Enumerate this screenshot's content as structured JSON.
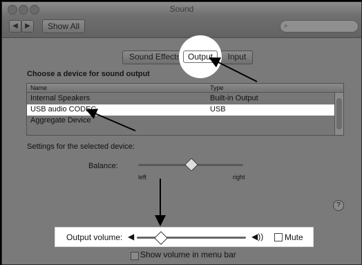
{
  "window": {
    "title": "Sound"
  },
  "toolbar": {
    "back_icon": "back-arrow-icon",
    "forward_icon": "forward-arrow-icon",
    "show_all": "Show All",
    "search_icon": "search-icon"
  },
  "tabs": [
    {
      "label": "Sound Effects"
    },
    {
      "label": "Output"
    },
    {
      "label": "Input"
    }
  ],
  "output": {
    "heading": "Choose a device for sound output",
    "columns": [
      "Name",
      "Type"
    ],
    "devices": [
      {
        "name": "Internal Speakers",
        "type": "Built-in Output"
      },
      {
        "name": "USB audio CODEC",
        "type": "USB"
      },
      {
        "name": "Aggregate Device",
        "type": ""
      }
    ]
  },
  "settings": {
    "label": "Settings for the selected device:",
    "balance_label": "Balance:",
    "left_label": "left",
    "right_label": "right",
    "balance_position": 0.5
  },
  "volume": {
    "label": "Output volume:",
    "level": 0.22,
    "mute_label": "Mute",
    "mute_checked": false
  },
  "menu_bar": {
    "label": "Show volume in menu bar",
    "checked": false
  },
  "help_icon": "help-icon"
}
